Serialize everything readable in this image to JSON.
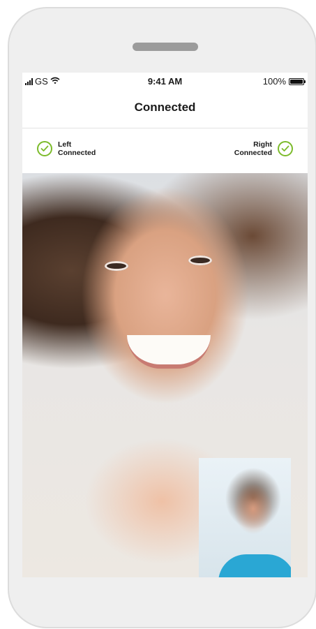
{
  "status_bar": {
    "carrier": "GS",
    "time": "9:41 AM",
    "battery": "100%"
  },
  "header": {
    "title": "Connected"
  },
  "hearing_aids": {
    "left": {
      "side": "Left",
      "status": "Connected"
    },
    "right": {
      "side": "Right",
      "status": "Connected"
    }
  },
  "controls": [
    {
      "name": "video-camera-icon"
    },
    {
      "name": "switch-camera-icon"
    },
    {
      "name": "microphone-icon"
    },
    {
      "name": "end-call-icon"
    }
  ],
  "colors": {
    "check_green": "#7cbb2b",
    "end_call_red": "#e8173a"
  }
}
